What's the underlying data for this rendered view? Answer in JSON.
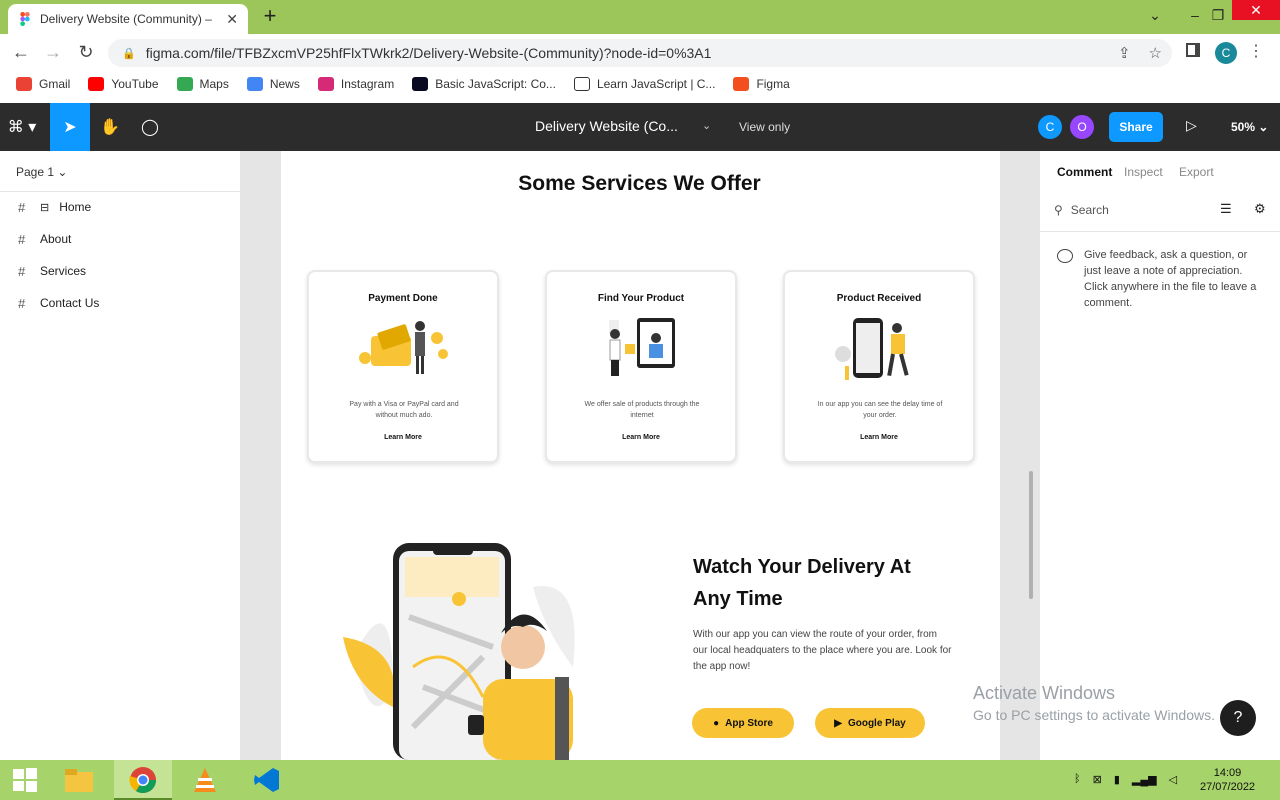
{
  "browser": {
    "tab_title": "Delivery Website (Community) –",
    "new_tab": "+",
    "url": "figma.com/file/TFBZxcmVP25hfFlxTWkrk2/Delivery-Website-(Community)?node-id=0%3A1",
    "profile_initial": "C"
  },
  "bookmarks": [
    {
      "label": "Gmail",
      "color": "#ea4335"
    },
    {
      "label": "YouTube",
      "color": "#ff0000"
    },
    {
      "label": "Maps",
      "color": "#34a853"
    },
    {
      "label": "News",
      "color": "#4285f4"
    },
    {
      "label": "Instagram",
      "color": "#d62976"
    },
    {
      "label": "Basic JavaScript: Co...",
      "color": "#0a0a23"
    },
    {
      "label": "Learn JavaScript | C...",
      "color": "#333333"
    },
    {
      "label": "Figma",
      "color": "#f24e1e"
    }
  ],
  "figma": {
    "file_title": "Delivery Website (Co...",
    "view_mode": "View only",
    "avatars": [
      {
        "initial": "C",
        "color": "#0d99ff"
      },
      {
        "initial": "O",
        "color": "#9747ff"
      }
    ],
    "share_label": "Share",
    "zoom": "50%"
  },
  "left_panel": {
    "page": "Page 1",
    "layers": [
      "Home",
      "About",
      "Services",
      "Contact Us"
    ]
  },
  "design": {
    "services_title": "Some Services We Offer",
    "cards": [
      {
        "title": "Payment Done",
        "desc": "Pay with a Visa or PayPal card and without much ado.",
        "link": "Learn More"
      },
      {
        "title": "Find Your Product",
        "desc": "We offer sale of products through the internet",
        "link": "Learn More"
      },
      {
        "title": "Product Received",
        "desc": "In our app you can see the delay time of your order.",
        "link": "Learn More"
      }
    ],
    "watch_title": "Watch Your Delivery At Any Time",
    "watch_desc": "With our app you can view the route of your order, from our local headquaters to the place where you are. Look for the app now!",
    "app_store": "App Store",
    "google_play": "Google Play",
    "accent_color": "#f8c436"
  },
  "right_panel": {
    "tabs": [
      "Comment",
      "Inspect",
      "Export"
    ],
    "search_placeholder": "Search",
    "message": "Give feedback, ask a question, or just leave a note of appreciation. Click anywhere in the file to leave a comment."
  },
  "windows": {
    "activate_title": "Activate Windows",
    "activate_sub": "Go to PC settings to activate Windows.",
    "time": "14:09",
    "date": "27/07/2022",
    "help": "?"
  }
}
